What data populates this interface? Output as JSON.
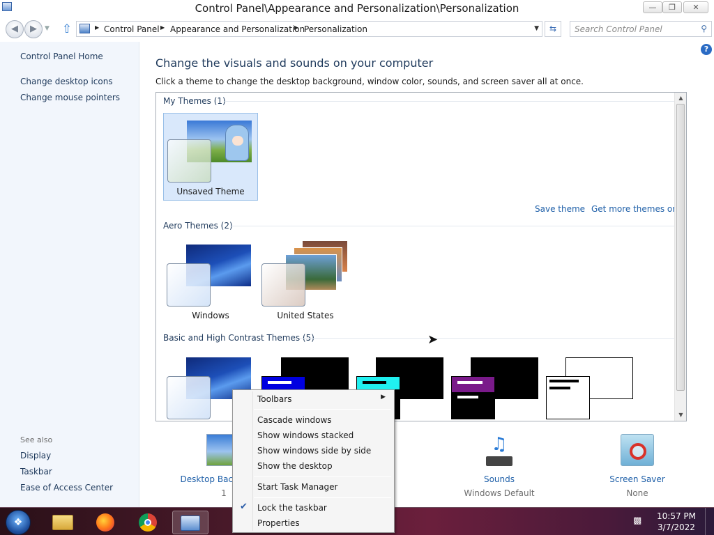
{
  "window": {
    "title": "Control Panel\\Appearance and Personalization\\Personalization",
    "minimize_icon": "minimize-icon",
    "maximize_icon": "restore-icon",
    "close_icon": "close-icon"
  },
  "address": {
    "crumbs": [
      "Control Panel",
      "Appearance and Personalization",
      "Personalization"
    ],
    "search_placeholder": "Search Control Panel"
  },
  "left_pane": {
    "links": [
      "Control Panel Home",
      "Change desktop icons",
      "Change mouse pointers"
    ],
    "see_also_label": "See also",
    "see_also": [
      "Display",
      "Taskbar",
      "Ease of Access Center"
    ]
  },
  "main": {
    "heading": "Change the visuals and sounds on your computer",
    "description": "Click a theme to change the desktop background, window color, sounds, and screen saver all at once.",
    "groups": {
      "my_themes": "My Themes (1)",
      "aero_themes": "Aero Themes (2)",
      "basic_themes": "Basic and High Contrast Themes (5)"
    },
    "my_themes": [
      {
        "label": "Unsaved Theme",
        "selected": true
      }
    ],
    "aero_themes": [
      {
        "label": "Windows"
      },
      {
        "label": "United States"
      }
    ],
    "actions": {
      "save_theme": "Save theme",
      "get_more": "Get more themes online"
    }
  },
  "bottom": {
    "desktop_background": {
      "label": "Desktop Background",
      "value": "1"
    },
    "sounds": {
      "label": "Sounds",
      "value": "Windows Default"
    },
    "screen_saver": {
      "label": "Screen Saver",
      "value": "None"
    }
  },
  "taskbar": {
    "time": "10:57 PM",
    "date": "3/7/2022",
    "apps": [
      "file-explorer-icon",
      "firefox-icon",
      "chrome-icon",
      "control-panel-icon"
    ]
  },
  "context_menu": {
    "items": [
      {
        "label": "Toolbars",
        "submenu": true
      },
      {
        "label": "Cascade windows"
      },
      {
        "label": "Show windows stacked"
      },
      {
        "label": "Show windows side by side"
      },
      {
        "label": "Show the desktop"
      },
      {
        "label": "Start Task Manager"
      },
      {
        "label": "Lock the taskbar",
        "checked": true
      },
      {
        "label": "Properties"
      }
    ]
  },
  "colors": {
    "link": "#1e5fa8",
    "heading": "#1e395b",
    "selected_bg": "#d9e8fb"
  }
}
